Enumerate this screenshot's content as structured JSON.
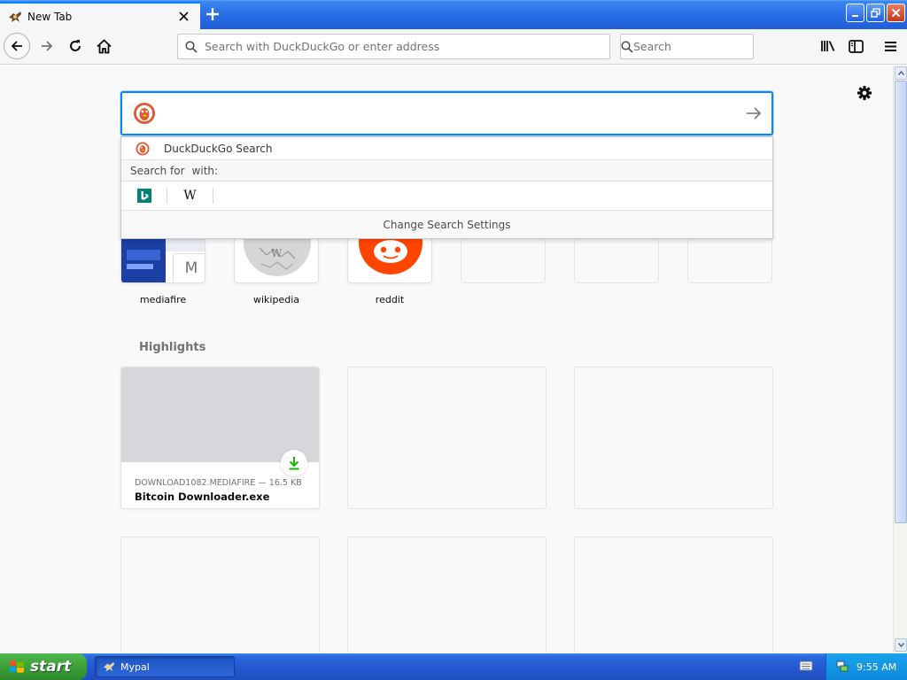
{
  "tab": {
    "title": "New Tab"
  },
  "navbar": {
    "url_placeholder": "Search with DuckDuckGo or enter address",
    "search_placeholder": "Search"
  },
  "search": {
    "suggestion": "DuckDuckGo Search",
    "search_for_label": "Search for",
    "with_label": "with:",
    "engines": [
      "bing",
      "wikipedia"
    ],
    "wikipedia_glyph": "W",
    "settings_label": "Change Search Settings"
  },
  "top_sites": [
    {
      "label": "mediafire",
      "badge": "M"
    },
    {
      "label": "wikipedia"
    },
    {
      "label": "reddit"
    },
    {
      "label": ""
    },
    {
      "label": ""
    },
    {
      "label": ""
    }
  ],
  "highlights": {
    "title": "Highlights",
    "card": {
      "meta": "DOWNLOAD1082.MEDIAFIRE — 16.5 KB",
      "title": "Bitcoin Downloader.exe"
    }
  },
  "taskbar": {
    "start_label": "start",
    "task_label": "Mypal",
    "clock": "9:55 AM"
  },
  "colors": {
    "accent": "#0a84ff",
    "download": "#12bc00",
    "reddit": "#ff4500",
    "ddg": "#de5833",
    "bing": "#008373"
  }
}
